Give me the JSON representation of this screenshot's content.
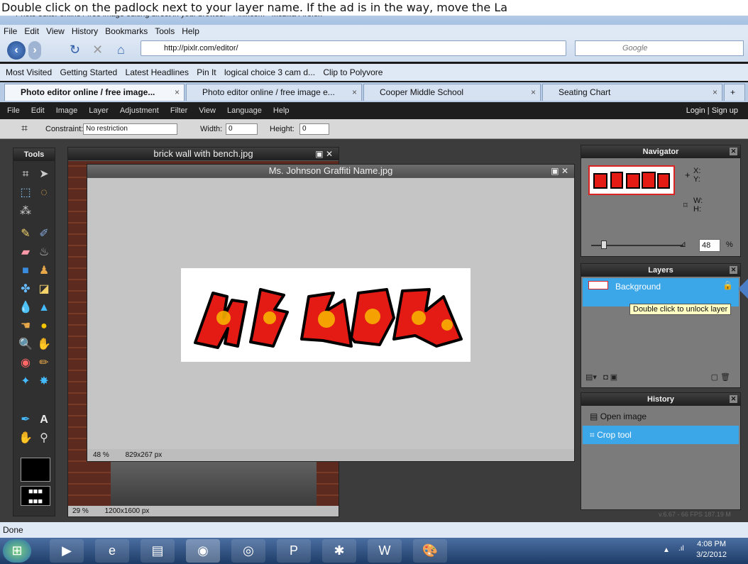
{
  "caption": "Double click on the padlock next to your layer name. If the ad is in the way, move the La",
  "browser": {
    "title": "Photo editor online / free image editing direct in your browser - Pixlr.com - Mozilla Firefox",
    "menu": [
      "File",
      "Edit",
      "View",
      "History",
      "Bookmarks",
      "Tools",
      "Help"
    ],
    "url": "http://pixlr.com/editor/",
    "search_placeholder": "Google",
    "bookmarks": [
      "Most Visited",
      "Getting Started",
      "Latest Headlines",
      "Pin It",
      "logical choice 3 cam d...",
      "Clip to Polyvore"
    ],
    "tabs": [
      {
        "label": "Photo editor online / free image...",
        "active": true
      },
      {
        "label": "Photo editor online / free image e...",
        "active": false
      },
      {
        "label": "Cooper Middle School",
        "active": false
      },
      {
        "label": "Seating Chart",
        "active": false
      }
    ],
    "status": "Done"
  },
  "app": {
    "menu": [
      "File",
      "Edit",
      "Image",
      "Layer",
      "Adjustment",
      "Filter",
      "View",
      "Language",
      "Help"
    ],
    "login": "Login",
    "signup": "Sign up",
    "options": {
      "constraint_label": "Constraint:",
      "constraint_value": "No restriction",
      "width_label": "Width:",
      "width_value": "0",
      "height_label": "Height:",
      "height_value": "0"
    },
    "tools_title": "Tools",
    "windows": {
      "brick": {
        "title": "brick wall with bench.jpg",
        "zoom": "29",
        "size": "1200x1600 px"
      },
      "graffiti": {
        "title": "Ms. Johnson Graffiti Name.jpg",
        "zoom": "48",
        "size": "829x267 px"
      }
    },
    "navigator": {
      "title": "Navigator",
      "x_label": "X:",
      "y_label": "Y:",
      "w_label": "W:",
      "h_label": "H:",
      "zoom": "48",
      "percent": "%"
    },
    "layers": {
      "title": "Layers",
      "layer_name": "Background",
      "tooltip": "Double click to unlock layer"
    },
    "history": {
      "title": "History",
      "items": [
        "Open image",
        "Crop tool"
      ]
    },
    "version": "v.6.67 - 66 FPS 187.19 M"
  },
  "percent_sign": "%",
  "taskbar": {
    "time": "4:08 PM",
    "date": "3/2/2012"
  }
}
